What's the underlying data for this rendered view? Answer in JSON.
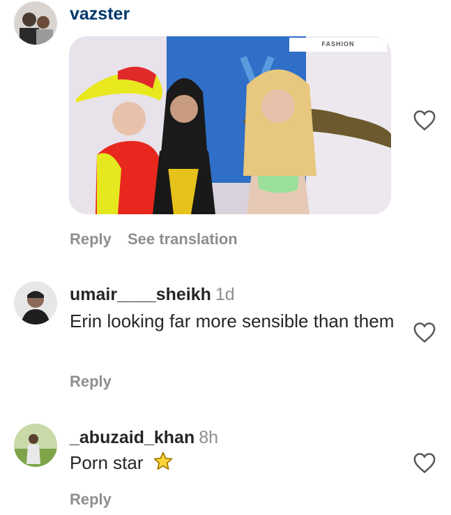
{
  "comments": [
    {
      "username": "vazster",
      "time": "",
      "text": "",
      "media_badge": "FASHION",
      "actions": [
        "Reply",
        "See translation"
      ]
    },
    {
      "username": "umair____sheikh",
      "time": "1d",
      "text": "Erin looking far more sensible than them",
      "actions": [
        "Reply"
      ]
    },
    {
      "username": "_abuzaid_khan",
      "time": "8h",
      "text": "Porn star",
      "emoji": "star",
      "actions": [
        "Reply"
      ]
    }
  ],
  "colors": {
    "text": "#262626",
    "secondary": "#8e8e8e",
    "link": "#00376b"
  }
}
